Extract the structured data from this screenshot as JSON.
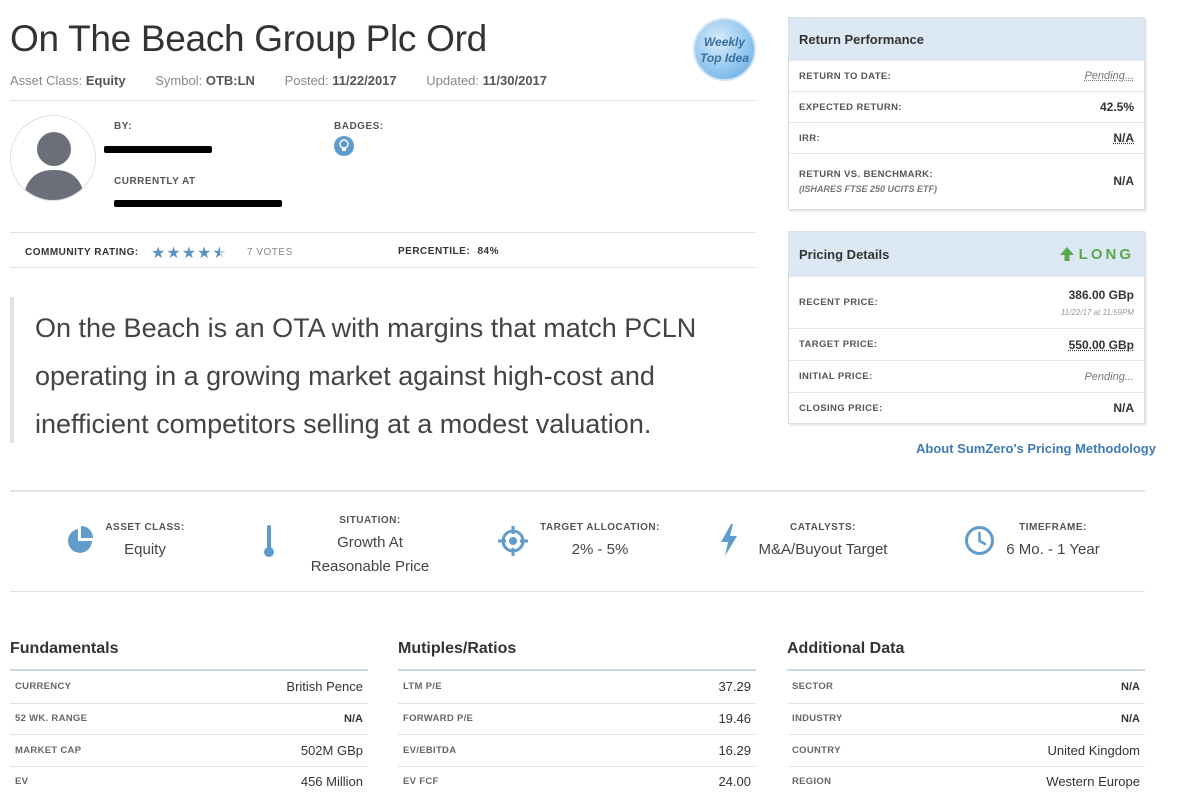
{
  "header": {
    "title": "On The Beach Group Plc Ord",
    "asset_class_label": "Asset Class:",
    "asset_class_value": "Equity",
    "symbol_label": "Symbol:",
    "symbol_value": "OTB:LN",
    "posted_label": "Posted:",
    "posted_value": "11/22/2017",
    "updated_label": "Updated:",
    "updated_value": "11/30/2017",
    "badge_line1": "Weekly",
    "badge_line2": "Top Idea"
  },
  "author": {
    "by_label": "BY:",
    "currently_at_label": "CURRENTLY AT",
    "badges_label": "BADGES:",
    "avatar_icon": "user-silhouette-icon",
    "badge_icon": "lightbulb-icon"
  },
  "rating": {
    "label": "COMMUNITY RATING:",
    "stars": 4.5,
    "votes": "7 VOTES",
    "percentile_label": "PERCENTILE:",
    "percentile_value": "84%"
  },
  "quote": "On the Beach is an OTA with margins that match PCLN operating in a growing market against high-cost and inefficient competitors selling at a modest valuation.",
  "return_performance": {
    "title": "Return Performance",
    "rows": [
      {
        "label": "RETURN TO DATE:",
        "value": "Pending..."
      },
      {
        "label": "EXPECTED RETURN:",
        "value": "42.5%"
      },
      {
        "label": "IRR:",
        "value": "N/A"
      },
      {
        "label": "RETURN VS. BENCHMARK:",
        "sublabel": "(ISHARES FTSE 250 UCITS ETF)",
        "value": "N/A"
      }
    ]
  },
  "pricing": {
    "title": "Pricing Details",
    "direction": "LONG",
    "direction_color": "#5ba84b",
    "rows": [
      {
        "label": "RECENT PRICE:",
        "value": "386.00 GBp",
        "subvalue": "11/22/17 at 11:59PM"
      },
      {
        "label": "TARGET PRICE:",
        "value": "550.00 GBp"
      },
      {
        "label": "INITIAL PRICE:",
        "value": "Pending..."
      },
      {
        "label": "CLOSING PRICE:",
        "value": "N/A"
      }
    ],
    "methodology_link": "About SumZero's Pricing Methodology"
  },
  "situation": [
    {
      "label": "ASSET CLASS:",
      "value": "Equity",
      "icon": "pie-chart-icon"
    },
    {
      "label": "SITUATION:",
      "value": "Growth At Reasonable Price",
      "icon": "thermometer-icon"
    },
    {
      "label": "TARGET ALLOCATION:",
      "value": "2% - 5%",
      "icon": "crosshair-icon"
    },
    {
      "label": "CATALYSTS:",
      "value": "M&A/Buyout Target",
      "icon": "lightning-icon"
    },
    {
      "label": "TIMEFRAME:",
      "value": "6 Mo. - 1 Year",
      "icon": "clock-icon"
    }
  ],
  "fundamentals": {
    "title": "Fundamentals",
    "rows": [
      {
        "label": "CURRENCY",
        "value": "British Pence"
      },
      {
        "label": "52 WK. RANGE",
        "value": "N/A"
      },
      {
        "label": "MARKET CAP",
        "value": "502M GBp"
      },
      {
        "label": "EV",
        "value": "456 Million"
      }
    ]
  },
  "multiples": {
    "title": "Mutiples/Ratios",
    "rows": [
      {
        "label": "LTM P/E",
        "value": "37.29"
      },
      {
        "label": "FORWARD P/E",
        "value": "19.46"
      },
      {
        "label": "EV/EBITDA",
        "value": "16.29"
      },
      {
        "label": "EV FCF",
        "value": "24.00"
      }
    ]
  },
  "additional": {
    "title": "Additional Data",
    "rows": [
      {
        "label": "SECTOR",
        "value": "N/A"
      },
      {
        "label": "INDUSTRY",
        "value": "N/A"
      },
      {
        "label": "COUNTRY",
        "value": "United Kingdom"
      },
      {
        "label": "REGION",
        "value": "Western Europe"
      }
    ]
  },
  "colors": {
    "accent": "#5f9ccc",
    "panel_header": "#dce9f5",
    "link": "#3f7bb2"
  }
}
